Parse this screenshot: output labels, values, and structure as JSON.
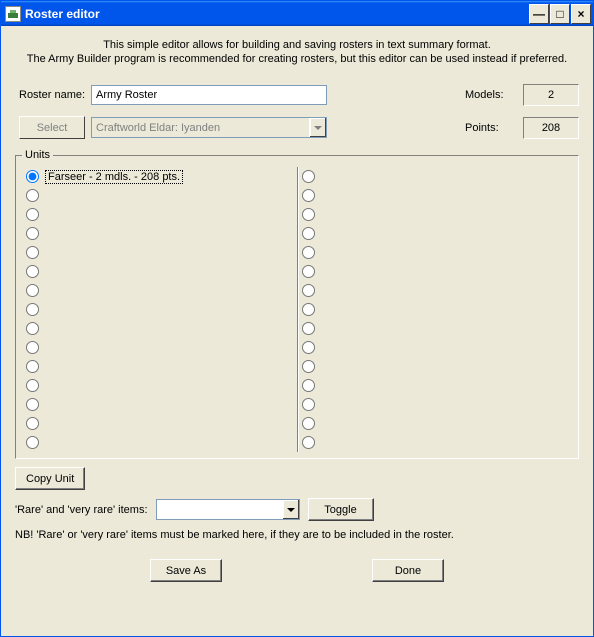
{
  "window": {
    "title": "Roster editor",
    "minimize_glyph": "—",
    "maximize_glyph": "□",
    "close_glyph": "×"
  },
  "intro": {
    "line1": "This simple editor allows for building and saving rosters in text summary format.",
    "line2": "The Army Builder program is recommended for creating rosters, but this editor can be used instead if preferred."
  },
  "form": {
    "roster_name_label": "Roster name:",
    "roster_name_value": "Army Roster",
    "select_button": "Select",
    "army_combo_value": "Craftworld Eldar: Iyanden",
    "models_label": "Models:",
    "models_value": "2",
    "points_label": "Points:",
    "points_value": "208"
  },
  "units": {
    "legend": "Units",
    "left": [
      "Farseer - 2 mdls. - 208 pts.",
      "",
      "",
      "",
      "",
      "",
      "",
      "",
      "",
      "",
      "",
      "",
      "",
      "",
      ""
    ],
    "right": [
      "",
      "",
      "",
      "",
      "",
      "",
      "",
      "",
      "",
      "",
      "",
      "",
      "",
      "",
      ""
    ],
    "selected_index": 0
  },
  "copy_unit_button": "Copy Unit",
  "rare": {
    "label": "'Rare' and 'very rare' items:",
    "combo_value": "",
    "toggle_button": "Toggle",
    "note": "NB! 'Rare' or 'very rare' items must be marked here, if they are to be included in the roster."
  },
  "buttons": {
    "save_as": "Save As",
    "done": "Done"
  }
}
